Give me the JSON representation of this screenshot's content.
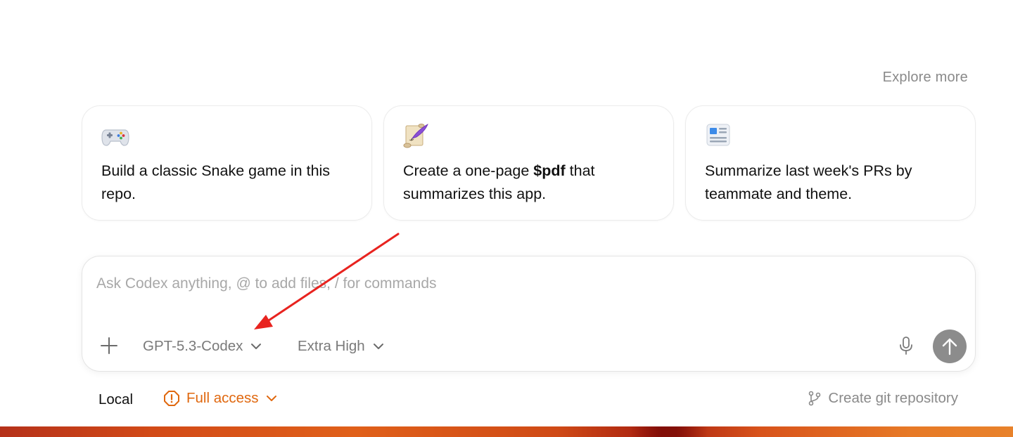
{
  "header": {
    "explore_more": "Explore more"
  },
  "suggestions": [
    {
      "icon": "game-controller-icon",
      "text_before": "Build a classic Snake game in this repo.",
      "bold": "",
      "text_after": ""
    },
    {
      "icon": "scroll-quill-icon",
      "text_before": "Create a one-page ",
      "bold": "$pdf",
      "text_after": " that summarizes this app."
    },
    {
      "icon": "newspaper-icon",
      "text_before": "Summarize last week's PRs by teammate and theme.",
      "bold": "",
      "text_after": ""
    }
  ],
  "composer": {
    "placeholder": "Ask Codex anything, @ to add files, / for commands",
    "value": "",
    "model": "GPT-5.3-Codex",
    "reasoning": "Extra High"
  },
  "footer": {
    "location": "Local",
    "access": "Full access",
    "git": "Create git repository"
  },
  "colors": {
    "accent_orange": "#e0680f",
    "send_button": "#8c8c8c",
    "annotation_arrow": "#e8231f"
  }
}
